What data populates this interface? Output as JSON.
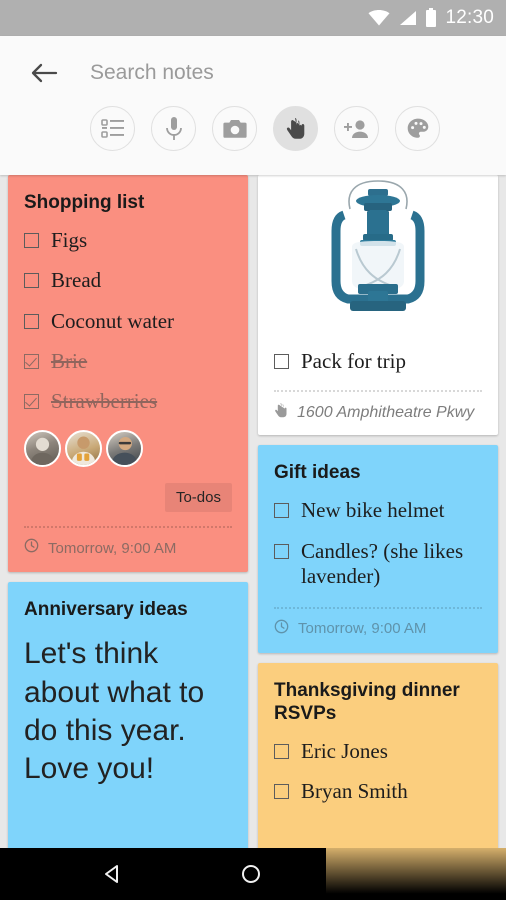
{
  "status_bar": {
    "time": "12:30",
    "icons": [
      "wifi-icon",
      "signal-icon",
      "battery-icon"
    ]
  },
  "header": {
    "back_icon": "back-arrow-icon",
    "search_placeholder": "Search notes",
    "search_value": "",
    "action_icons": [
      {
        "name": "checklist-icon",
        "label": "New list",
        "active": false
      },
      {
        "name": "microphone-icon",
        "label": "New voice note",
        "active": false
      },
      {
        "name": "camera-icon",
        "label": "New photo note",
        "active": false
      },
      {
        "name": "drawing-hand-icon",
        "label": "New drawing",
        "active": true
      },
      {
        "name": "add-person-icon",
        "label": "Add collaborator",
        "active": false
      },
      {
        "name": "palette-icon",
        "label": "Change color",
        "active": false
      }
    ]
  },
  "colors": {
    "salmon": "#FA8F80",
    "blue": "#7FD4FB",
    "orange": "#FBCE7E",
    "white": "#FFFFFF",
    "background": "#E8E8E8",
    "status_bar": "#B0B0B0",
    "header": "#FAFAFA"
  },
  "notes": {
    "shopping_list": {
      "title": "Shopping list",
      "items": [
        {
          "text": "Figs",
          "checked": false
        },
        {
          "text": "Bread",
          "checked": false
        },
        {
          "text": "Coconut water",
          "checked": false
        },
        {
          "text": "Brie",
          "checked": true
        },
        {
          "text": "Strawberries",
          "checked": true
        }
      ],
      "collaborators": 3,
      "chip_label": "To-dos",
      "reminder_icon": "clock-icon",
      "reminder": "Tomorrow, 9:00 AM"
    },
    "anniversary": {
      "title": "Anniversary ideas",
      "body": "Let's think about what to do this year. Love you!"
    },
    "pack_for_trip": {
      "image_alt": "blue-lantern-photo",
      "items": [
        {
          "text": "Pack for trip",
          "checked": false
        }
      ],
      "location_icon": "location-icon",
      "location": "1600 Amphitheatre Pkwy"
    },
    "gift_ideas": {
      "title": "Gift ideas",
      "items": [
        {
          "text": "New bike helmet",
          "checked": false
        },
        {
          "text": "Candles? (she likes lavender)",
          "checked": false
        }
      ],
      "reminder_icon": "clock-icon",
      "reminder": "Tomorrow, 9:00 AM"
    },
    "thanksgiving": {
      "title": "Thanksgiving dinner RSVPs",
      "items": [
        {
          "text": "Eric Jones",
          "checked": false
        },
        {
          "text": "Bryan Smith",
          "checked": false
        }
      ]
    }
  },
  "nav_bar": {
    "back_label": "Back",
    "home_label": "Home"
  }
}
